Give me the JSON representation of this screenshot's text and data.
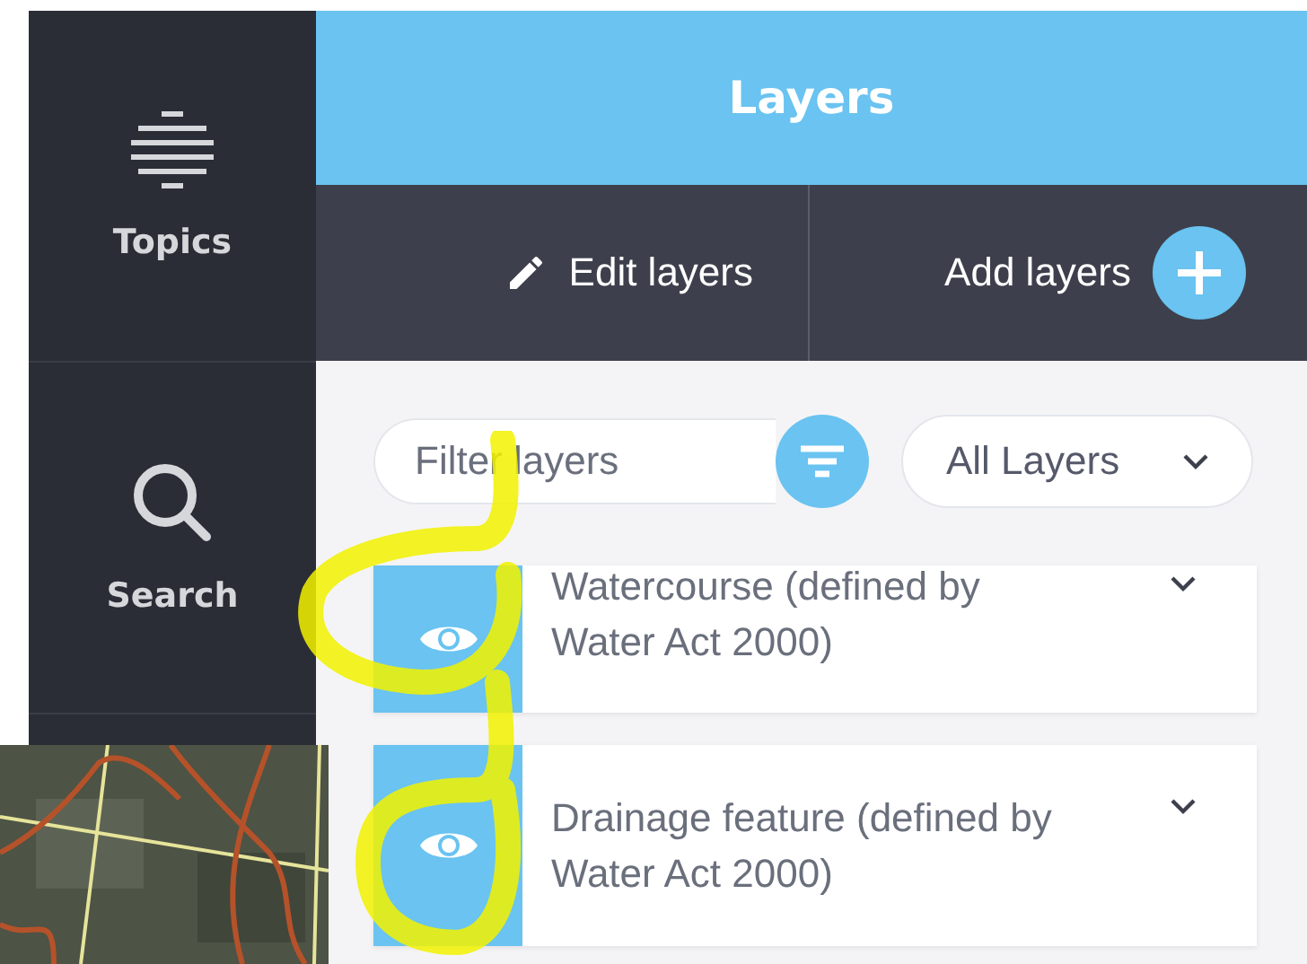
{
  "sidebar": {
    "items": [
      {
        "kind": "topics",
        "label": "Topics"
      },
      {
        "kind": "search",
        "label": "Search"
      }
    ]
  },
  "header": {
    "title": "Layers"
  },
  "toolbar": {
    "edit": "Edit layers",
    "add": "Add layers"
  },
  "filter": {
    "placeholder": "Filter layers",
    "scope": "All Layers"
  },
  "layers": [
    {
      "name": "Watercourse (defined by Water Act 2000)",
      "visible": true,
      "color": "#6ac3f0"
    },
    {
      "name": "Drainage feature (defined by Water Act 2000)",
      "visible": true,
      "color": "#6ac3f0"
    }
  ]
}
